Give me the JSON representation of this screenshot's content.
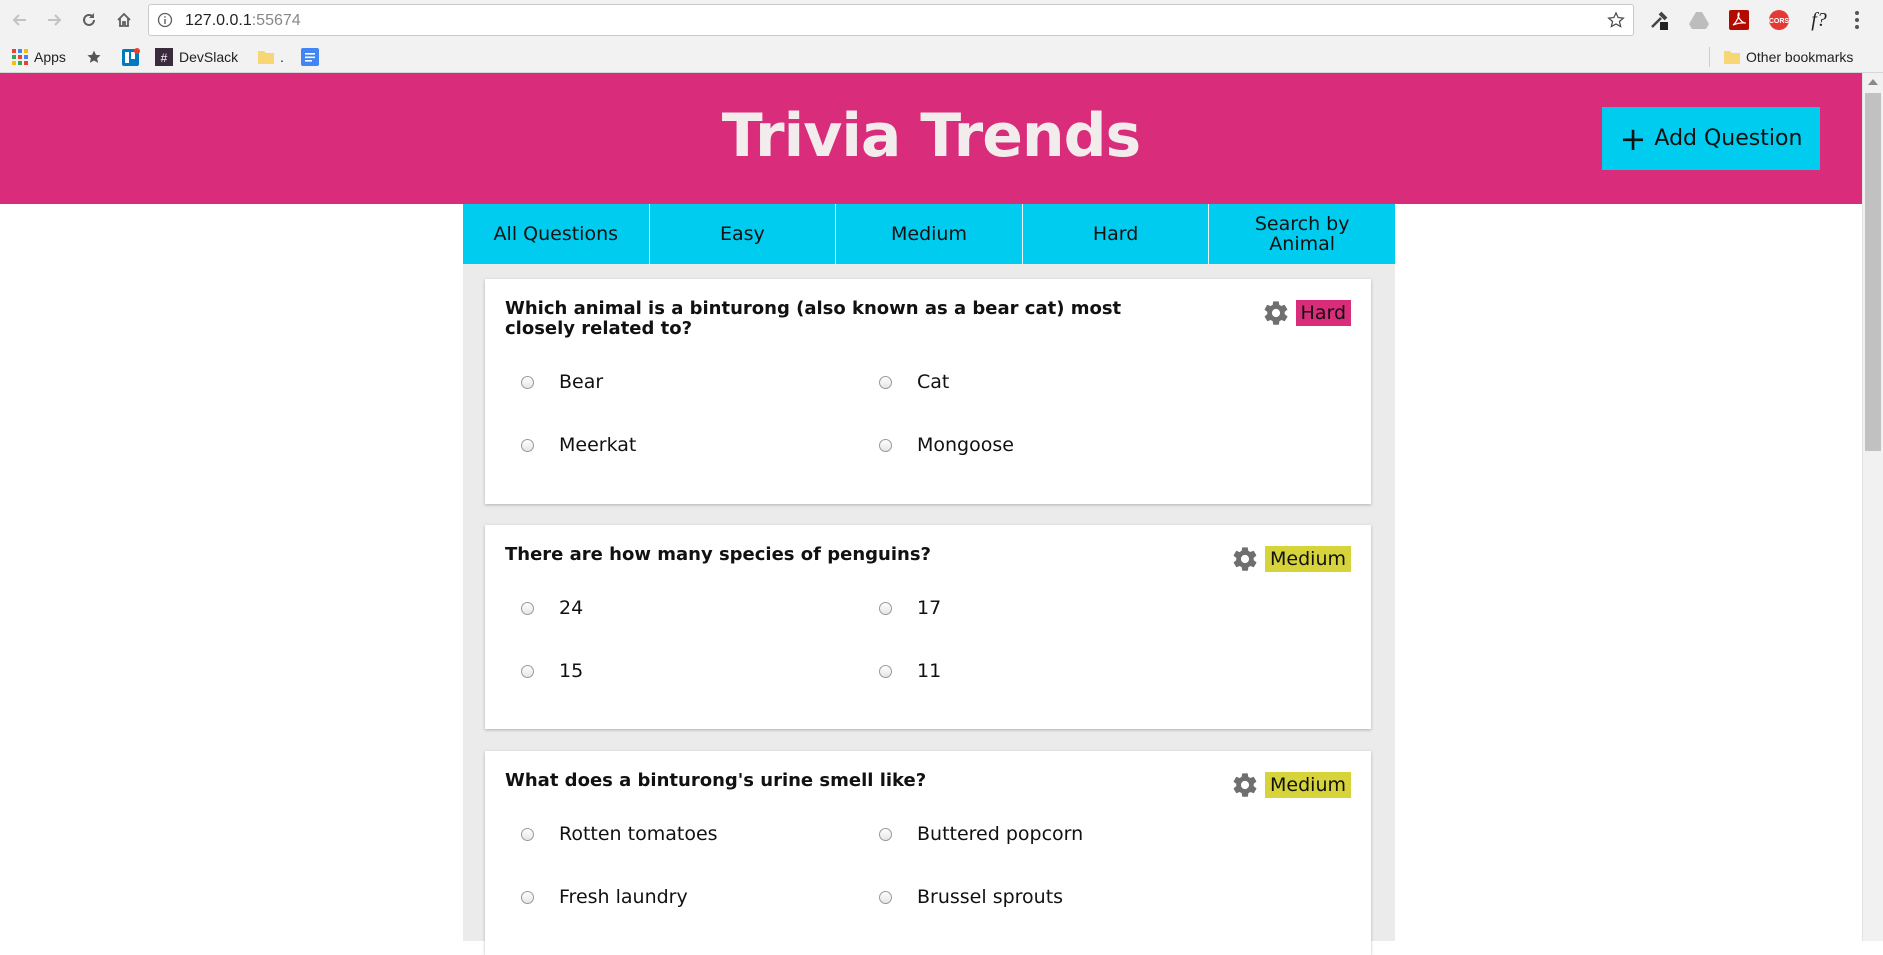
{
  "browser": {
    "url_host": "127.0.0.1",
    "url_port": ":55674",
    "bookmarks": [
      {
        "label": "Apps",
        "icon": "apps-grid-icon"
      },
      {
        "label": "",
        "icon": "star-bookmark-icon"
      },
      {
        "label": "",
        "icon": "trello-icon"
      },
      {
        "label": "DevSlack",
        "icon": "slack-icon"
      },
      {
        "label": ".",
        "icon": "folder-icon"
      },
      {
        "label": "",
        "icon": "docs-icon"
      }
    ],
    "other_bookmarks": "Other bookmarks",
    "extensions": [
      "eyedropper-icon",
      "drive-icon",
      "pdf-icon",
      "cors-icon",
      "formula-icon",
      "menu-dots-icon"
    ],
    "cors_label": "CORS",
    "formula_label": "f?"
  },
  "header": {
    "title": "Trivia Trends",
    "add_button": "Add Question",
    "add_icon": "+"
  },
  "nav": {
    "tabs": [
      "All Questions",
      "Easy",
      "Medium",
      "Hard",
      "Search by Animal"
    ]
  },
  "questions": [
    {
      "text": "Which animal is a binturong (also known as a bear cat) most closely related to?",
      "difficulty": "Hard",
      "answers": [
        "Bear",
        "Cat",
        "Meerkat",
        "Mongoose"
      ]
    },
    {
      "text": "There are how many species of penguins?",
      "difficulty": "Medium",
      "answers": [
        "24",
        "17",
        "15",
        "11"
      ]
    },
    {
      "text": "What does a binturong's urine smell like?",
      "difficulty": "Medium",
      "answers": [
        "Rotten tomatoes",
        "Buttered popcorn",
        "Fresh laundry",
        "Brussel sprouts"
      ]
    }
  ],
  "colors": {
    "brand_pink": "#d92c7b",
    "accent_cyan": "#00ccf0",
    "medium_badge": "#d6d33b",
    "content_bg": "#ebebeb"
  }
}
